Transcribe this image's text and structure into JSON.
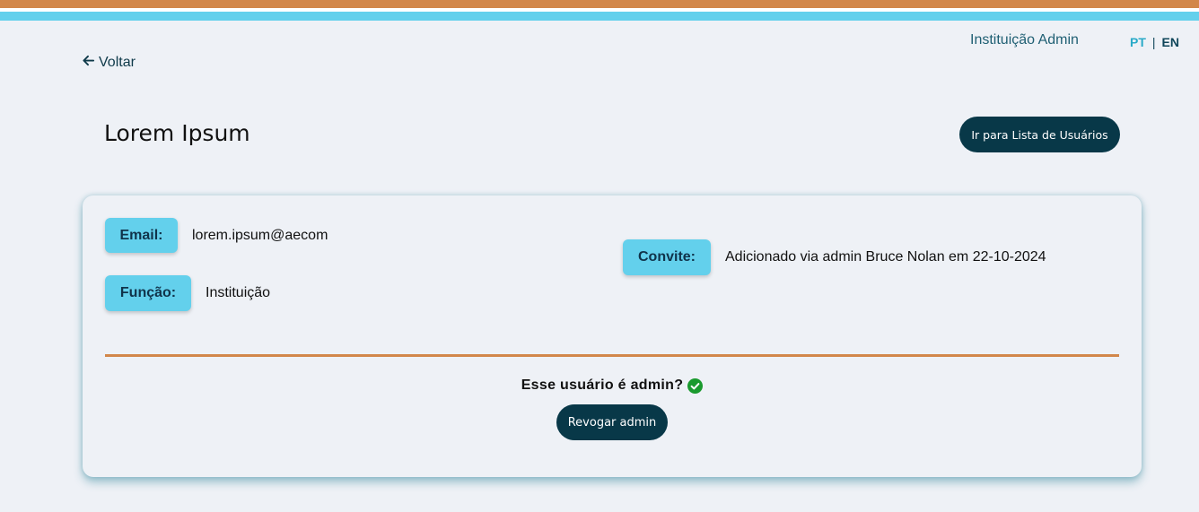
{
  "header": {
    "user_label": "Instituição Admin",
    "lang_pt": "PT",
    "lang_separator": "|",
    "lang_en": "EN"
  },
  "nav": {
    "back_label": "Voltar"
  },
  "page": {
    "title": "Lorem Ipsum",
    "go_users_label": "Ir para Lista de Usuários"
  },
  "details": {
    "email_label": "Email:",
    "email_value": "lorem.ipsum@aecom",
    "role_label": "Função:",
    "role_value": "Instituição",
    "invite_label": "Convite:",
    "invite_value": "Adicionado via admin Bruce Nolan em 22-10-2024"
  },
  "admin": {
    "question": "Esse usuário é admin?",
    "status_icon": "check-circle-icon",
    "revoke_label": "Revogar admin"
  },
  "colors": {
    "accent_orange": "#d2874a",
    "accent_blue": "#63d0ec",
    "dark_button": "#083848",
    "check_green": "#1a9a2e"
  }
}
